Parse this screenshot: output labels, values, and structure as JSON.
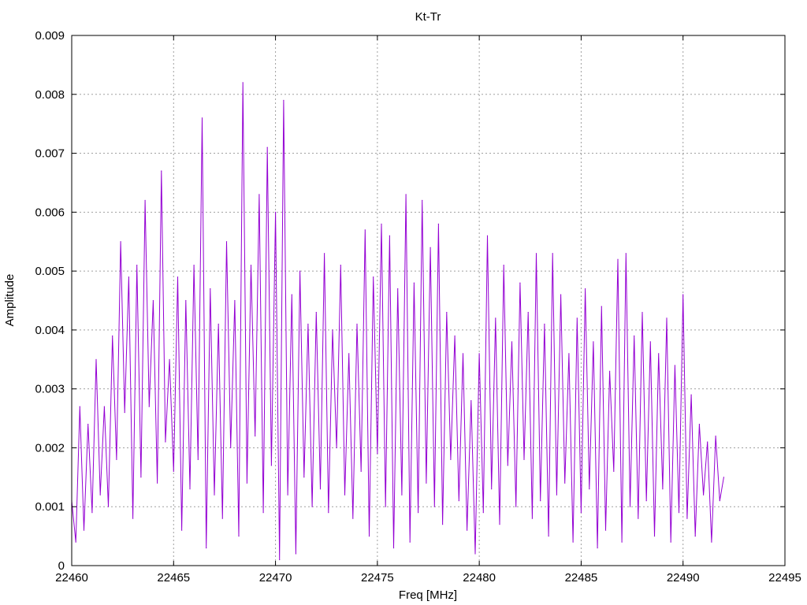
{
  "chart_data": {
    "type": "line",
    "title": "Kt-Tr",
    "xlabel": "Freq [MHz]",
    "ylabel": "Amplitude",
    "xlim": [
      22460,
      22495
    ],
    "ylim": [
      0,
      0.009
    ],
    "grid": true,
    "legend": "none",
    "x_ticks": [
      "22460",
      "22465",
      "22470",
      "22475",
      "22480",
      "22485",
      "22490",
      "22495"
    ],
    "y_ticks": [
      "0",
      "0.001",
      "0.002",
      "0.003",
      "0.004",
      "0.005",
      "0.006",
      "0.007",
      "0.008",
      "0.009"
    ],
    "series": [
      {
        "name": "Kt-Tr",
        "color": "#9400d3",
        "x_start": 22460,
        "x_step": 0.2,
        "values": [
          0.0011,
          0.0004,
          0.0027,
          0.0006,
          0.0024,
          0.0009,
          0.0035,
          0.0012,
          0.0027,
          0.001,
          0.0039,
          0.0018,
          0.0055,
          0.0026,
          0.0049,
          0.0008,
          0.0051,
          0.0015,
          0.0062,
          0.0027,
          0.0045,
          0.0014,
          0.0067,
          0.0021,
          0.0035,
          0.0016,
          0.0049,
          0.0006,
          0.0045,
          0.0013,
          0.0051,
          0.0018,
          0.0076,
          0.0003,
          0.0047,
          0.0012,
          0.0041,
          0.0008,
          0.0055,
          0.002,
          0.0045,
          0.0005,
          0.0082,
          0.0014,
          0.0051,
          0.0022,
          0.0063,
          0.0009,
          0.0071,
          0.0017,
          0.006,
          0.0001,
          0.0079,
          0.0012,
          0.0046,
          0.0002,
          0.005,
          0.0015,
          0.0041,
          0.001,
          0.0043,
          0.0013,
          0.0053,
          0.0009,
          0.004,
          0.002,
          0.0051,
          0.0012,
          0.0036,
          0.0008,
          0.0041,
          0.0016,
          0.0057,
          0.0005,
          0.0049,
          0.0019,
          0.0058,
          0.001,
          0.0056,
          0.0003,
          0.0047,
          0.0012,
          0.0063,
          0.0004,
          0.0048,
          0.0009,
          0.0062,
          0.0014,
          0.0054,
          0.001,
          0.0058,
          0.0007,
          0.0043,
          0.0018,
          0.0039,
          0.0011,
          0.0036,
          0.0006,
          0.0028,
          0.0002,
          0.0036,
          0.0009,
          0.0056,
          0.0013,
          0.0042,
          0.0007,
          0.0051,
          0.0017,
          0.0038,
          0.001,
          0.0048,
          0.0018,
          0.0043,
          0.0008,
          0.0053,
          0.0011,
          0.0041,
          0.0005,
          0.0053,
          0.0012,
          0.0046,
          0.0014,
          0.0036,
          0.0004,
          0.0042,
          0.0009,
          0.0047,
          0.0013,
          0.0038,
          0.0003,
          0.0044,
          0.0006,
          0.0033,
          0.0016,
          0.0052,
          0.0004,
          0.0053,
          0.001,
          0.0039,
          0.0008,
          0.0043,
          0.0011,
          0.0038,
          0.0005,
          0.0036,
          0.0013,
          0.0042,
          0.0004,
          0.0034,
          0.0009,
          0.0046,
          0.0008,
          0.0029,
          0.0005,
          0.0024,
          0.0012,
          0.0021,
          0.0004,
          0.0022,
          0.0011,
          0.0015
        ]
      }
    ]
  }
}
